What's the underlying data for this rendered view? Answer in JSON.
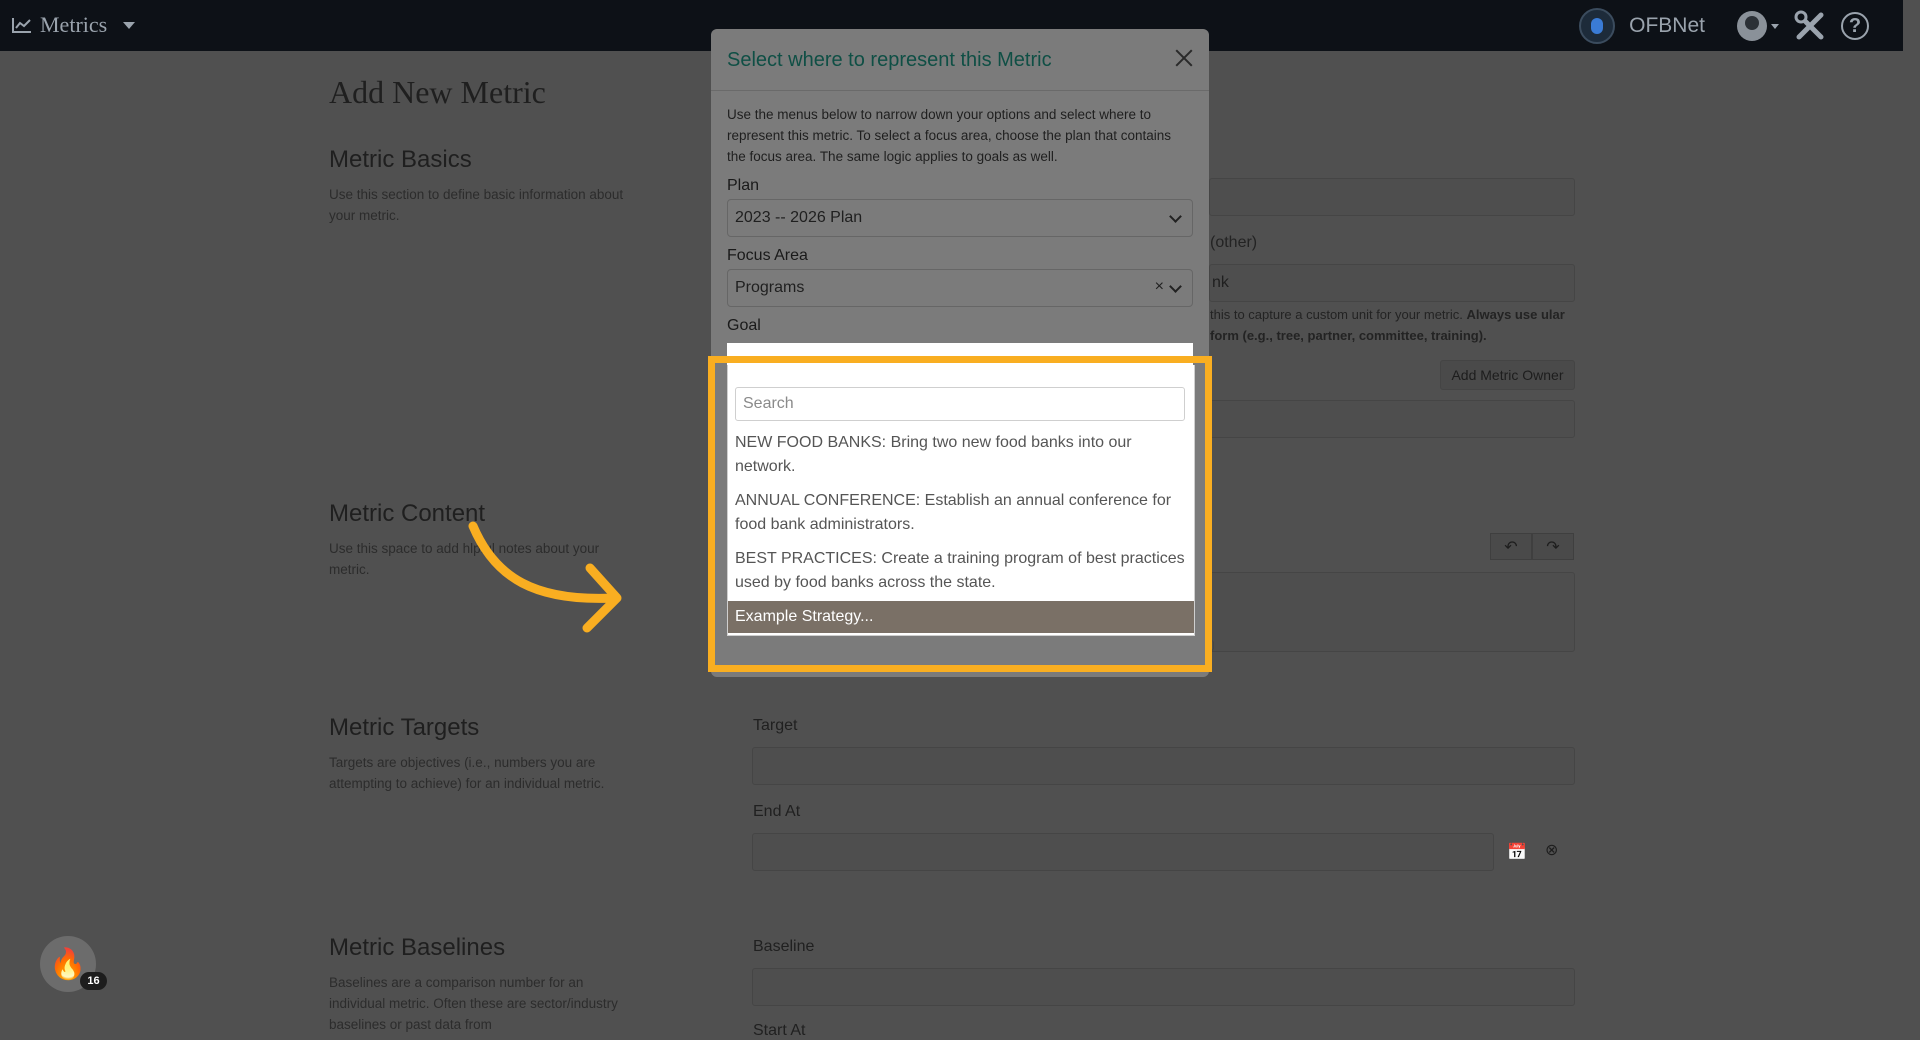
{
  "navbar": {
    "app_name": "Metrics",
    "org_name": "OFBNet"
  },
  "page": {
    "title": "Add New Metric",
    "sections": {
      "basics": {
        "title": "Metric Basics",
        "desc": "Use this section to define basic information about your metric."
      },
      "content": {
        "title": "Metric Content",
        "desc_part1": "Use this space to add h",
        "desc_part2": "lpful notes about your metric."
      },
      "targets": {
        "title": "Metric Targets",
        "desc": "Targets are objectives (i.e., numbers you are attempting to achieve) for an individual metric."
      },
      "baselines": {
        "title": "Metric Baselines",
        "desc": "Baselines are a comparison number for an individual metric. Often these are sector/industry baselines or past data from"
      }
    },
    "form": {
      "unit_other_label": "(other)",
      "unit_value_fragment": "nk",
      "unit_help_fragment_1": "this to capture a custom unit for your metric.",
      "unit_help_bold_1": "Always use",
      "unit_help_bold_2": "ular form (e.g., tree, partner, committee, training).",
      "add_owner_label": "Add Metric Owner",
      "target_label": "Target",
      "end_at_label": "End At",
      "baseline_label": "Baseline",
      "start_at_label": "Start At"
    }
  },
  "modal": {
    "title": "Select where to represent this Metric",
    "description": "Use the menus below to narrow down your options and select where to represent this metric. To select a focus area, choose the plan that contains the focus area. The same logic applies to goals as well.",
    "plan_label": "Plan",
    "plan_value": "2023 -- 2026 Plan",
    "focus_area_label": "Focus Area",
    "focus_area_value": "Programs",
    "goal_label": "Goal"
  },
  "dropdown": {
    "search_placeholder": "Search",
    "options": [
      "NEW FOOD BANKS: Bring two new food banks into our network.",
      "ANNUAL CONFERENCE: Establish an annual conference for food bank administrators.",
      "BEST PRACTICES: Create a training program of best practices used by food banks across the state.",
      "Example Strategy..."
    ],
    "active_index": 3
  },
  "badge": {
    "count": "16"
  },
  "colors": {
    "highlight": "#f9ae21",
    "modal_title": "#0f4f45",
    "active_option": "#7a7066"
  }
}
